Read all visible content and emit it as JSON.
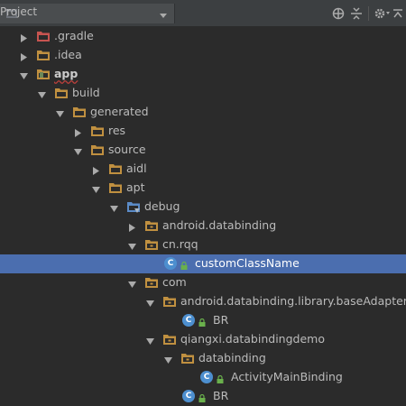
{
  "toolbar": {
    "view_label": "Project",
    "icons": [
      "project-folder-icon",
      "chevron-down-icon",
      "locate-target-icon",
      "collapse-all-icon",
      "gear-icon",
      "hide-panel-icon"
    ]
  },
  "tree": {
    "rows": [
      {
        "label": "gradle_hidden",
        "text": ".gradle",
        "icon": "folder-red"
      },
      {
        "text": ".idea"
      },
      {
        "text": "app"
      },
      {
        "text": "build"
      },
      {
        "text": "generated"
      },
      {
        "text": "res"
      },
      {
        "text": "source"
      },
      {
        "text": "aidl"
      },
      {
        "text": "apt"
      },
      {
        "text": "debug"
      },
      {
        "text": "android.databinding"
      },
      {
        "text": "cn.rqq"
      },
      {
        "text": "customClassName"
      },
      {
        "text": "com"
      },
      {
        "text": "android.databinding.library.baseAdapters"
      },
      {
        "text": "BR"
      },
      {
        "text": "qiangxi.databindingdemo"
      },
      {
        "text": "databinding"
      },
      {
        "text": "ActivityMainBinding"
      },
      {
        "text": "BR"
      }
    ]
  },
  "colors": {
    "background": "#2b2b2b",
    "toolbar": "#3c3f41",
    "selection": "#4b6eaf",
    "folder": "#c09040",
    "excluded_folder": "#c75450",
    "class_badge": "#4d8fcf",
    "lock": "#6ab04c"
  }
}
